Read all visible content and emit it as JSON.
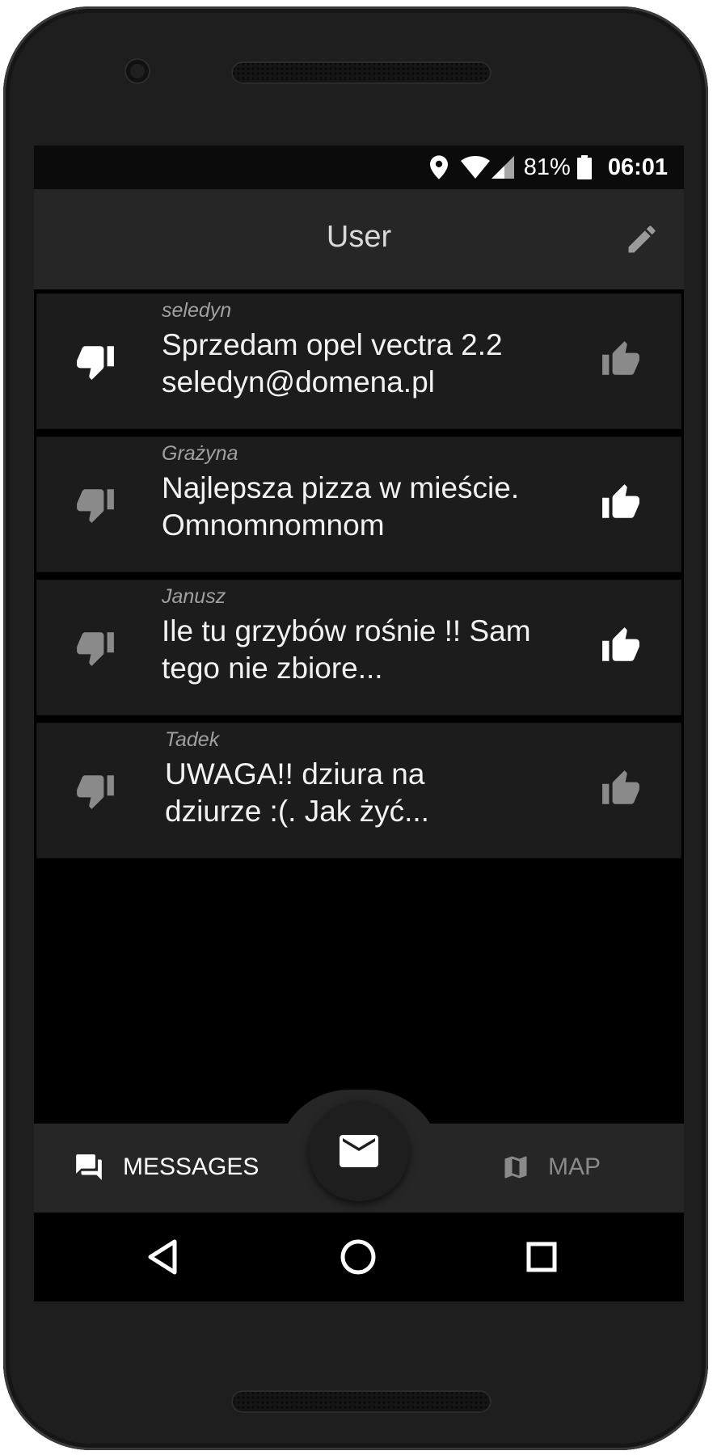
{
  "status_bar": {
    "battery_percent": "81%",
    "time": "06:01",
    "icons": [
      "location-icon",
      "wifi-icon",
      "signal-icon",
      "battery-icon"
    ]
  },
  "app_bar": {
    "title": "User",
    "edit_icon": "pencil-icon"
  },
  "messages": [
    {
      "author": "seledyn",
      "text": "Sprzedam opel vectra 2.2\nseledyn@domena.pl",
      "vote": "down"
    },
    {
      "author": "Grażyna",
      "text": "Najlepsza pizza w mieście.\nOmnomnomnom",
      "vote": "up"
    },
    {
      "author": "Janusz",
      "text": "Ile tu grzybów rośnie !! Sam\ntego nie zbiore...",
      "vote": "up"
    },
    {
      "author": "Tadek",
      "text": "UWAGA!! dziura na\ndziurze :(.  Jak żyć...",
      "vote": "none"
    }
  ],
  "bottom_nav": {
    "messages_label": "MESSAGES",
    "map_label": "MAP",
    "fab_icon": "envelope-icon"
  },
  "colors": {
    "active_icon": "#ffffff",
    "inactive_icon": "#8a8a8a",
    "card_bg": "#1c1c1c",
    "bar_bg": "#262626"
  }
}
